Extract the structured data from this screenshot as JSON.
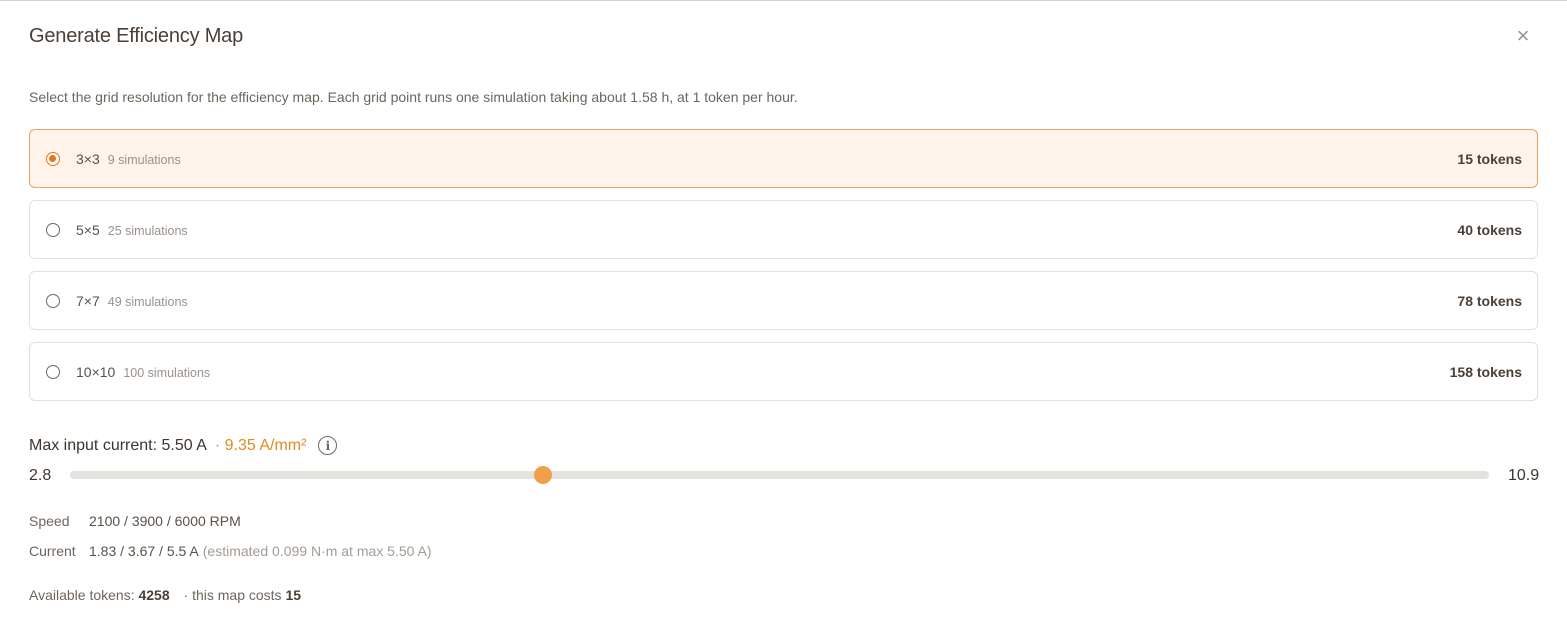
{
  "dialog": {
    "title": "Generate Efficiency Map",
    "close_glyph": "×",
    "description": "Select the grid resolution for the efficiency map. Each grid point runs one simulation taking about 1.58 h, at 1 token per hour."
  },
  "options": [
    {
      "label": "3×3",
      "sub": "9 simulations",
      "cost": "15 tokens",
      "selected": true
    },
    {
      "label": "5×5",
      "sub": "25 simulations",
      "cost": "40 tokens",
      "selected": false
    },
    {
      "label": "7×7",
      "sub": "49 simulations",
      "cost": "78 tokens",
      "selected": false
    },
    {
      "label": "10×10",
      "sub": "100 simulations",
      "cost": "158 tokens",
      "selected": false
    }
  ],
  "current_slider": {
    "title": "Max input current: 5.50 A",
    "density": "· 9.35 A/mm²",
    "min_label": "2.8",
    "max_label": "10.9",
    "min": 2.8,
    "max": 10.9,
    "value": 5.5
  },
  "speed": {
    "label": "Speed",
    "value": "2100 / 3900 / 6000 RPM"
  },
  "current": {
    "label": "Current",
    "value": "1.83 / 3.67 / 5.5 A",
    "estimate": "(estimated 0.099 N·m at max 5.50 A)"
  },
  "footer": {
    "available_label": "Available tokens:",
    "available_value": "4258",
    "cost_label": "· this map costs",
    "cost_value": "15"
  },
  "colors": {
    "accent": "#e8741a",
    "slider_thumb": "#f0a04b",
    "density": "#e08a1e"
  },
  "icons": {
    "close": "close-icon",
    "info": "info-icon"
  }
}
